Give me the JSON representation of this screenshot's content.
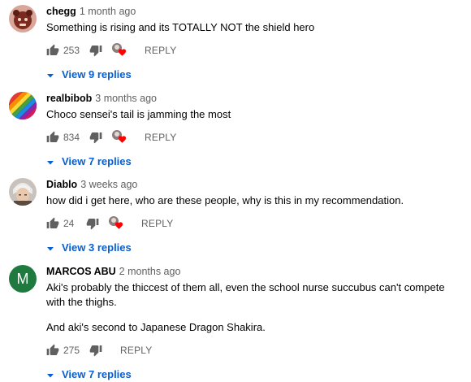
{
  "comments": [
    {
      "author": "chegg",
      "time": "1 month ago",
      "text": [
        "Something is rising and its TOTALLY NOT the shield hero"
      ],
      "likes": "253",
      "creator_heart": true,
      "reply_label": "REPLY",
      "view_replies": "View 9 replies"
    },
    {
      "author": "realbibob",
      "time": "3 months ago",
      "text": [
        "Choco sensei's tail is jamming the most"
      ],
      "likes": "834",
      "creator_heart": true,
      "reply_label": "REPLY",
      "view_replies": "View 7 replies"
    },
    {
      "author": "Diablo",
      "time": "3 weeks ago",
      "text": [
        "how did i get here, who are these people, why is this in my recommendation."
      ],
      "likes": "24",
      "creator_heart": true,
      "reply_label": "REPLY",
      "view_replies": "View 3 replies"
    },
    {
      "author": "MARCOS ABU",
      "time": "2 months ago",
      "text": [
        "Aki's probably the thiccest of them all, even the school nurse succubus can't compete with the thighs.",
        "And aki's second to Japanese Dragon Shakira."
      ],
      "likes": "275",
      "creator_heart": false,
      "avatar_letter": "M",
      "reply_label": "REPLY",
      "view_replies": "View 7 replies"
    }
  ],
  "colors": {
    "link_blue": "#065fd4",
    "heart_red": "#ff0000",
    "muted_text": "#606060",
    "avatar_green": "#1e7a3e"
  },
  "icons": [
    "thumbs-up-icon",
    "thumbs-down-icon",
    "creator-heart-icon",
    "caret-down-icon"
  ]
}
